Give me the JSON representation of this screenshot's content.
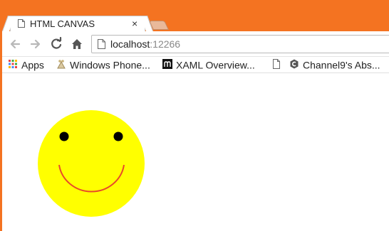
{
  "tab": {
    "title": "HTML CANVAS",
    "close_glyph": "×"
  },
  "address": {
    "host": "localhost",
    "port": ":12266"
  },
  "bookmarks": [
    {
      "label": "Apps",
      "icon": "apps-grid-icon"
    },
    {
      "label": "Windows Phone...",
      "icon": "windows-phone-icon"
    },
    {
      "label": "XAML Overview...",
      "icon": "m-logo-icon"
    },
    {
      "label": "",
      "icon": "blank-page-icon"
    },
    {
      "label": "Channel9's Abs...",
      "icon": "channel9-icon"
    }
  ],
  "colors": {
    "chrome_frame": "#f47321",
    "face_fill": "#ffff00",
    "eye_fill": "#000000",
    "smile_stroke": "#e8492a"
  }
}
